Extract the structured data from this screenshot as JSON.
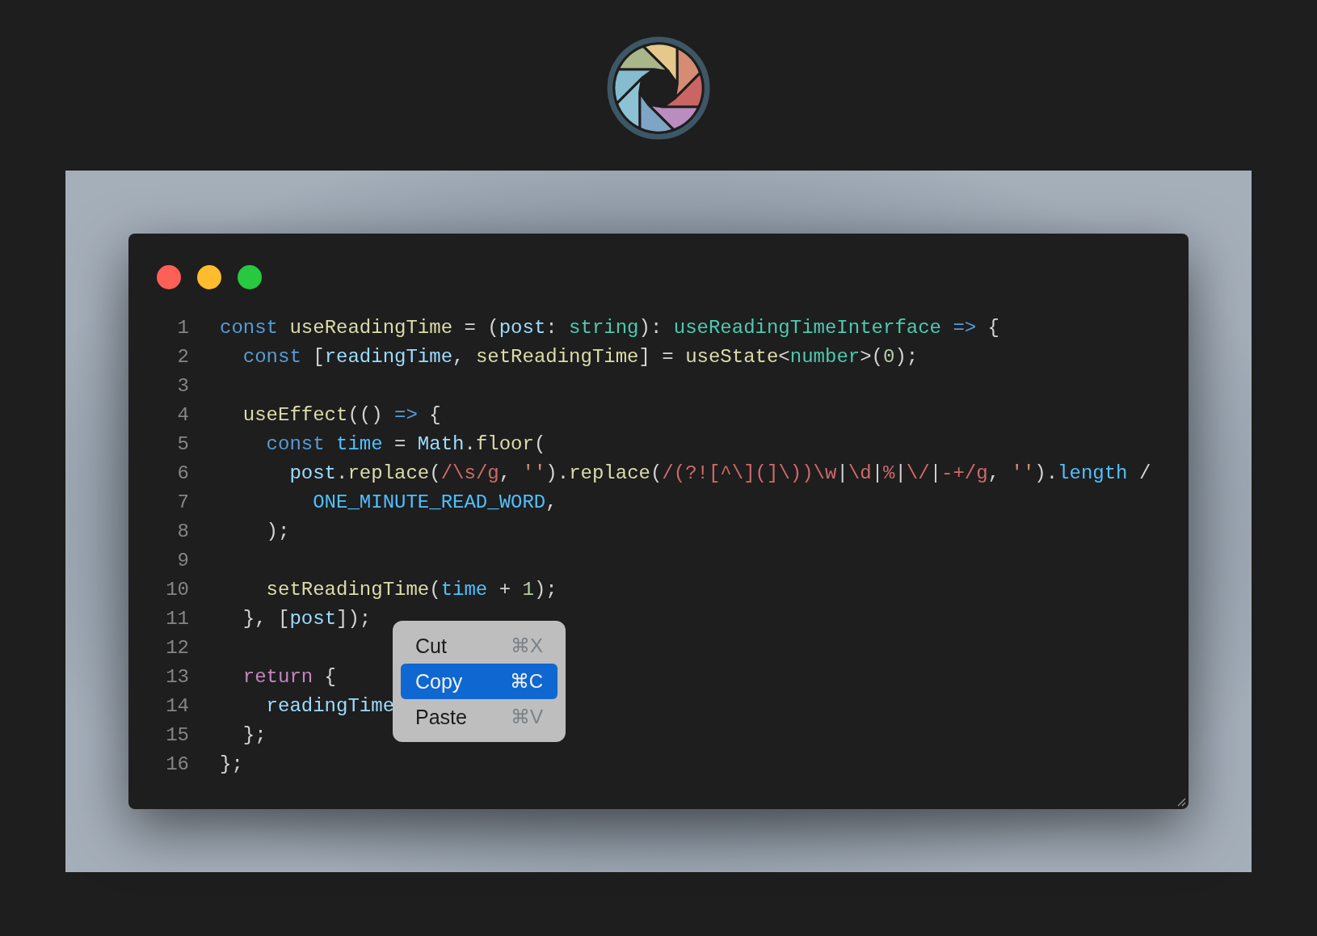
{
  "window": {
    "controls": [
      {
        "kind": "close"
      },
      {
        "kind": "minimize"
      },
      {
        "kind": "zoom"
      }
    ]
  },
  "code": {
    "lines": [
      {
        "number": "1",
        "tokens": [
          {
            "text": "const ",
            "kind": "keyword"
          },
          {
            "text": "useReadingTime",
            "kind": "function"
          },
          {
            "text": " = (",
            "kind": "plain"
          },
          {
            "text": "post",
            "kind": "variable"
          },
          {
            "text": ": ",
            "kind": "plain"
          },
          {
            "text": "string",
            "kind": "type"
          },
          {
            "text": "): ",
            "kind": "plain"
          },
          {
            "text": "useReadingTimeInterface",
            "kind": "type"
          },
          {
            "text": " =>",
            "kind": "keyword"
          },
          {
            "text": " {",
            "kind": "plain"
          }
        ]
      },
      {
        "number": "2",
        "tokens": [
          {
            "text": "  const",
            "kind": "keyword"
          },
          {
            "text": " [",
            "kind": "plain"
          },
          {
            "text": "readingTime",
            "kind": "variable"
          },
          {
            "text": ", ",
            "kind": "plain"
          },
          {
            "text": "setReadingTime",
            "kind": "function"
          },
          {
            "text": "] = ",
            "kind": "plain"
          },
          {
            "text": "useState",
            "kind": "function"
          },
          {
            "text": "<",
            "kind": "plain"
          },
          {
            "text": "number",
            "kind": "type"
          },
          {
            "text": ">(",
            "kind": "plain"
          },
          {
            "text": "0",
            "kind": "number"
          },
          {
            "text": ");",
            "kind": "plain"
          }
        ]
      },
      {
        "number": "3"
      },
      {
        "number": "4",
        "tokens": [
          {
            "text": "  useEffect",
            "kind": "function"
          },
          {
            "text": "(() ",
            "kind": "plain"
          },
          {
            "text": "=>",
            "kind": "keyword"
          },
          {
            "text": " {",
            "kind": "plain"
          }
        ]
      },
      {
        "number": "5",
        "tokens": [
          {
            "text": "    const ",
            "kind": "keyword"
          },
          {
            "text": "time",
            "kind": "constant"
          },
          {
            "text": " = ",
            "kind": "plain"
          },
          {
            "text": "Math",
            "kind": "variable"
          },
          {
            "text": ".",
            "kind": "plain"
          },
          {
            "text": "floor",
            "kind": "function"
          },
          {
            "text": "(",
            "kind": "plain"
          }
        ]
      },
      {
        "number": "6",
        "tokens": [
          {
            "text": "      post",
            "kind": "variable"
          },
          {
            "text": ".",
            "kind": "plain"
          },
          {
            "text": "replace",
            "kind": "function"
          },
          {
            "text": "(",
            "kind": "plain"
          },
          {
            "text": "/\\s/g",
            "kind": "regex"
          },
          {
            "text": ", ",
            "kind": "plain"
          },
          {
            "text": "''",
            "kind": "string"
          },
          {
            "text": ").",
            "kind": "plain"
          },
          {
            "text": "replace",
            "kind": "function"
          },
          {
            "text": "(",
            "kind": "plain"
          },
          {
            "text": "/(?![^\\](]\\))\\w",
            "kind": "regex"
          },
          {
            "text": "|",
            "kind": "plain"
          },
          {
            "text": "\\d",
            "kind": "regex"
          },
          {
            "text": "|",
            "kind": "plain"
          },
          {
            "text": "%",
            "kind": "regex"
          },
          {
            "text": "|",
            "kind": "plain"
          },
          {
            "text": "\\/",
            "kind": "regex"
          },
          {
            "text": "|",
            "kind": "plain"
          },
          {
            "text": "-+/g",
            "kind": "regex"
          },
          {
            "text": ", ",
            "kind": "plain"
          },
          {
            "text": "''",
            "kind": "string"
          },
          {
            "text": ").",
            "kind": "plain"
          },
          {
            "text": "length",
            "kind": "constant"
          },
          {
            "text": " /",
            "kind": "plain"
          }
        ]
      },
      {
        "number": "7",
        "tokens": [
          {
            "text": "        ONE_MINUTE_READ_WORD",
            "kind": "constant"
          },
          {
            "text": ",",
            "kind": "plain"
          }
        ]
      },
      {
        "number": "8",
        "tokens": [
          {
            "text": "    );",
            "kind": "plain"
          }
        ]
      },
      {
        "number": "9"
      },
      {
        "number": "10",
        "tokens": [
          {
            "text": "    setReadingTime",
            "kind": "function"
          },
          {
            "text": "(",
            "kind": "plain"
          },
          {
            "text": "time",
            "kind": "constant"
          },
          {
            "text": " + ",
            "kind": "plain"
          },
          {
            "text": "1",
            "kind": "number"
          },
          {
            "text": ");",
            "kind": "plain"
          }
        ]
      },
      {
        "number": "11",
        "tokens": [
          {
            "text": "  }, [",
            "kind": "plain"
          },
          {
            "text": "post",
            "kind": "variable"
          },
          {
            "text": "]);",
            "kind": "plain"
          }
        ]
      },
      {
        "number": "12"
      },
      {
        "number": "13",
        "tokens": [
          {
            "text": "  return",
            "kind": "control"
          },
          {
            "text": " {",
            "kind": "plain"
          }
        ]
      },
      {
        "number": "14",
        "tokens": [
          {
            "text": "    readingTime",
            "kind": "variable"
          }
        ]
      },
      {
        "number": "15",
        "tokens": [
          {
            "text": "  };",
            "kind": "plain"
          }
        ]
      },
      {
        "number": "16",
        "tokens": [
          {
            "text": "};",
            "kind": "plain"
          }
        ]
      }
    ]
  },
  "context_menu": {
    "items": [
      {
        "label": "Cut",
        "shortcut": "⌘X",
        "selected": false
      },
      {
        "label": "Copy",
        "shortcut": "⌘C",
        "selected": true
      },
      {
        "label": "Paste",
        "shortcut": "⌘V",
        "selected": false
      }
    ]
  }
}
